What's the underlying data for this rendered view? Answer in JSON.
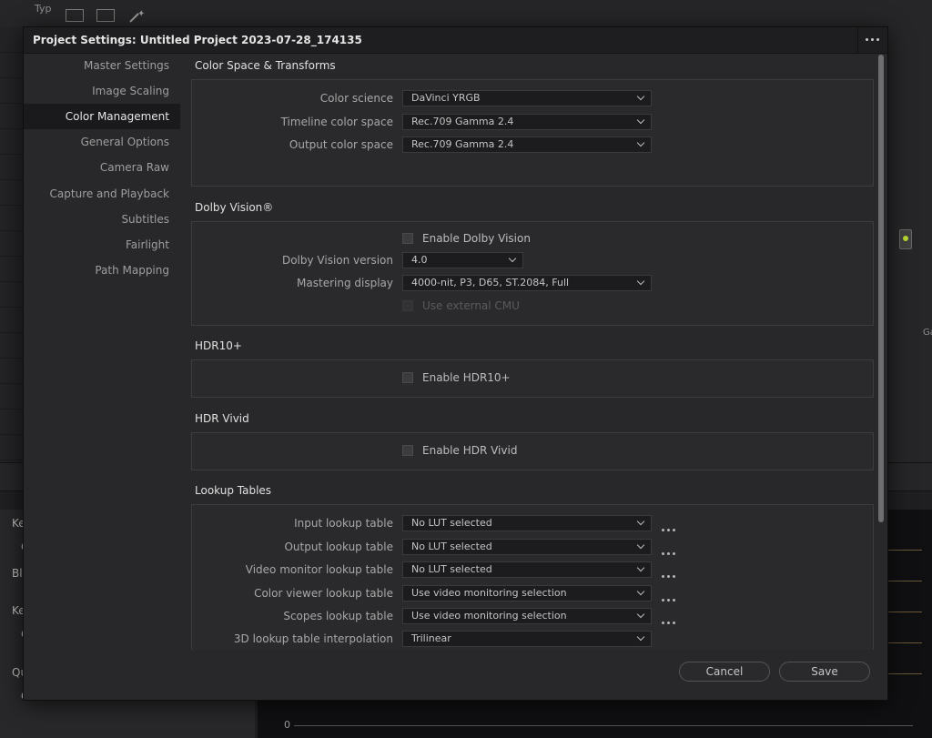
{
  "background": {
    "top_label": "Typ",
    "right_side_text": "Ga",
    "bottom_left_labels": [
      "Ke",
      "C",
      "Blu",
      "Ke",
      "C",
      "Qu",
      "C"
    ],
    "scope_zero": "0",
    "node_dot_color": "#b8d832"
  },
  "dialog": {
    "title": "Project Settings:  Untitled Project 2023-07-28_174135",
    "more_icon": "more-horizontal-icon"
  },
  "sidebar": {
    "items": [
      {
        "label": "Master Settings",
        "active": false
      },
      {
        "label": "Image Scaling",
        "active": false
      },
      {
        "label": "Color Management",
        "active": true
      },
      {
        "label": "General Options",
        "active": false
      },
      {
        "label": "Camera Raw",
        "active": false
      },
      {
        "label": "Capture and Playback",
        "active": false
      },
      {
        "label": "Subtitles",
        "active": false
      },
      {
        "label": "Fairlight",
        "active": false
      },
      {
        "label": "Path Mapping",
        "active": false
      }
    ]
  },
  "sections": {
    "color_space": {
      "title": "Color Space & Transforms",
      "color_science": {
        "label": "Color science",
        "value": "DaVinci YRGB"
      },
      "timeline_color_space": {
        "label": "Timeline color space",
        "value": "Rec.709 Gamma 2.4"
      },
      "output_color_space": {
        "label": "Output color space",
        "value": "Rec.709 Gamma 2.4"
      }
    },
    "dolby": {
      "title": "Dolby Vision®",
      "enable": {
        "label": "Enable Dolby Vision",
        "checked": false
      },
      "version": {
        "label": "Dolby Vision version",
        "value": "4.0"
      },
      "mastering_display": {
        "label": "Mastering display",
        "value": "4000-nit, P3, D65, ST.2084, Full"
      },
      "external_cmu": {
        "label": "Use external CMU",
        "checked": false,
        "disabled": true
      }
    },
    "hdr10plus": {
      "title": "HDR10+",
      "enable": {
        "label": "Enable HDR10+",
        "checked": false
      }
    },
    "hdr_vivid": {
      "title": "HDR Vivid",
      "enable": {
        "label": "Enable HDR Vivid",
        "checked": false
      }
    },
    "lut": {
      "title": "Lookup Tables",
      "input": {
        "label": "Input lookup table",
        "value": "No LUT selected"
      },
      "output": {
        "label": "Output lookup table",
        "value": "No LUT selected"
      },
      "video_monitor": {
        "label": "Video monitor lookup table",
        "value": "No LUT selected"
      },
      "color_viewer": {
        "label": "Color viewer lookup table",
        "value": "Use video monitoring selection"
      },
      "scopes": {
        "label": "Scopes lookup table",
        "value": "Use video monitoring selection"
      },
      "interpolation": {
        "label": "3D lookup table interpolation",
        "value": "Trilinear"
      }
    }
  },
  "footer": {
    "cancel_label": "Cancel",
    "save_label": "Save"
  }
}
